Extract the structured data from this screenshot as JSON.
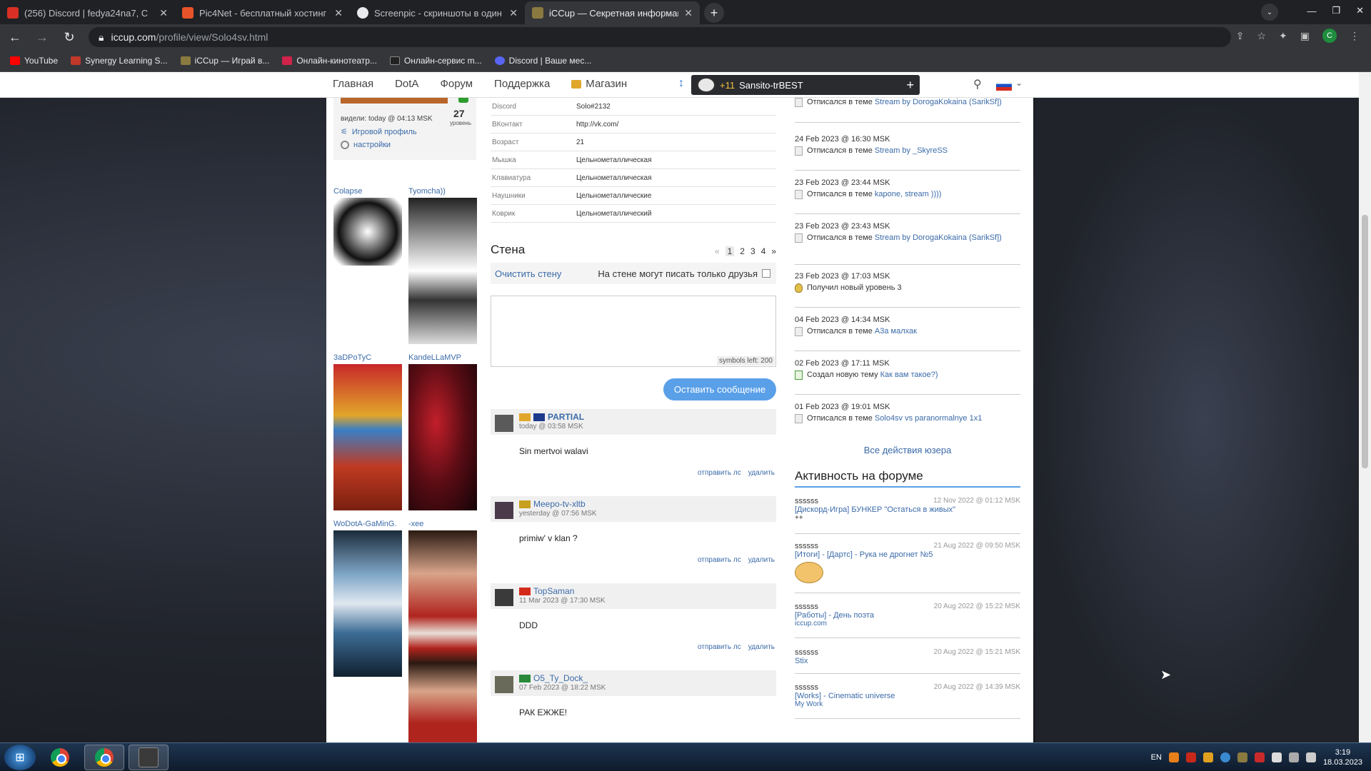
{
  "browser": {
    "tabs": [
      {
        "title": "(256) Discord | fedya24na7, С",
        "favicon_color": "#d93025",
        "active": false
      },
      {
        "title": "Pic4Net - бесплатный хостинг к",
        "favicon_color": "#e8532a",
        "active": false
      },
      {
        "title": "Screenpic - скриншоты в один к",
        "favicon_color": "#e8eaed",
        "active": false
      },
      {
        "title": "iCCup — Секретная информаци",
        "favicon_color": "#8a7a40",
        "active": true
      }
    ],
    "new_tab": "+",
    "address": {
      "host": "iccup.com",
      "path": "/profile/view/Solo4sv.html"
    },
    "profile_initial": "C",
    "bookmarks": [
      {
        "label": "YouTube",
        "color": "#ff0000"
      },
      {
        "label": "Synergy Learning S...",
        "color": "#c0392b"
      },
      {
        "label": "iCCup — Играй в...",
        "color": "#8a7a40"
      },
      {
        "label": "Онлайн-кинотеатр...",
        "color": "#d0234a"
      },
      {
        "label": "Онлайн-сервис m...",
        "color": "#222222"
      },
      {
        "label": "Discord | Ваше мес...",
        "color": "#5865f2"
      }
    ]
  },
  "site": {
    "nav": [
      "Главная",
      "DotA",
      "Форум",
      "Поддержка",
      "Магазин"
    ],
    "user_level": "+11",
    "user_name": "Sansito-trBEST",
    "profile": {
      "seen": "видели: today @ 04:13 MSK",
      "level": "27",
      "level_label": "уровень",
      "game_profile": "Игровой профиль",
      "settings": "настройки"
    },
    "friends": [
      "Colapse",
      "Tyomcha))",
      "3aDPoTyC",
      "KandeLLaMVP",
      "WoDotA-GaMinG.",
      "-xee"
    ],
    "info": [
      {
        "k": "Discord",
        "v": "Solo#2132"
      },
      {
        "k": "ВКонтакт",
        "v": "http://vk.com/"
      },
      {
        "k": "Возраст",
        "v": "21"
      },
      {
        "k": "Мышка",
        "v": "Цельнометаллическая"
      },
      {
        "k": "Клавиатура",
        "v": "Цельнометаллическая"
      },
      {
        "k": "Наушники",
        "v": "Цельнометаллические"
      },
      {
        "k": "Коврик",
        "v": "Цельнометаллический"
      }
    ],
    "wall": {
      "title": "Стена",
      "pager": [
        "«",
        "1",
        "2",
        "3",
        "4",
        "»"
      ],
      "clear": "Очистить стену",
      "friends_only": "На стене могут писать только друзья",
      "symbols_left": "symbols left: 200",
      "post_button": "Оставить сообщение",
      "send_pm": "отправить лс",
      "delete": "удалить",
      "posts": [
        {
          "nick": "PARTIAL",
          "date": "today @ 03:58 MSK",
          "text": "Sin mertvoi walavi",
          "badge_color": "#e0a72a"
        },
        {
          "nick": "Meepo-tv-xltb",
          "date": "yesterday @ 07:56 MSK",
          "text": "primiw' v klan ?",
          "badge_color": "#c8a020"
        },
        {
          "nick": "TopSaman",
          "date": "11 Mar 2023 @ 17:30 MSK",
          "text": "DDD",
          "badge_color": "#d42a1a"
        },
        {
          "nick": "O5_Ty_Dock_",
          "date": "07 Feb 2023 @ 18:22 MSK",
          "text": "РАК ЕЖЖЕ!",
          "badge_color": "#2a8a3a"
        }
      ]
    },
    "activity": [
      {
        "date": "",
        "action": "Отписался в теме",
        "link": "Stream by DorogaKokaina (SarikSf])",
        "icon": "doc"
      },
      {
        "date": "24 Feb 2023 @ 16:30 MSK",
        "action": "Отписался в теме",
        "link": "Stream by _SkyreSS",
        "icon": "doc"
      },
      {
        "date": "23 Feb 2023 @ 23:44 MSK",
        "action": "Отписался в теме",
        "link": "kapone, stream ))))",
        "icon": "doc"
      },
      {
        "date": "23 Feb 2023 @ 23:43 MSK",
        "action": "Отписался в теме",
        "link": "Stream by DorogaKokaina (SarikSf])",
        "icon": "doc"
      },
      {
        "date": "23 Feb 2023 @ 17:03 MSK",
        "action": "Получил новый уровень",
        "link": "3",
        "icon": "level"
      },
      {
        "date": "04 Feb 2023 @ 14:34 MSK",
        "action": "Отписался в теме",
        "link": "A3a малхак",
        "icon": "doc"
      },
      {
        "date": "02 Feb 2023 @ 17:11 MSK",
        "action": "Создал новую тему",
        "link": "Как вам такое?)",
        "icon": "new"
      },
      {
        "date": "01 Feb 2023 @ 19:01 MSK",
        "action": "Отписался в теме",
        "link": "Solo4sv vs paranormalnye 1x1",
        "icon": "doc"
      }
    ],
    "all_actions": "Все действия юзера",
    "forum_title": "Активность на форуме",
    "forum": [
      {
        "user": "ssssss",
        "date": "12 Nov 2022 @ 01:12 MSK",
        "topic": "[Дискорд-Игра] БУНКЕР \"Остаться в живых\"",
        "sub": "++"
      },
      {
        "user": "ssssss",
        "date": "21 Aug 2022 @ 09:50 MSK",
        "topic": "[Итоги] - [Дартс] - Рука не дрогнет №5",
        "sub": ""
      },
      {
        "user": "ssssss",
        "date": "20 Aug 2022 @ 15:22 MSK",
        "topic": "[Работы] - День поэта",
        "sub": "iccup.com"
      },
      {
        "user": "ssssss",
        "date": "20 Aug 2022 @ 15:21 MSK",
        "topic": "Stix",
        "sub": ""
      },
      {
        "user": "ssssss",
        "date": "20 Aug 2022 @ 14:39 MSK",
        "topic": "[Works] - Cinematic universe",
        "sub": "My Work"
      }
    ]
  },
  "taskbar": {
    "lang": "EN",
    "time": "3:19",
    "date": "18.03.2023"
  }
}
